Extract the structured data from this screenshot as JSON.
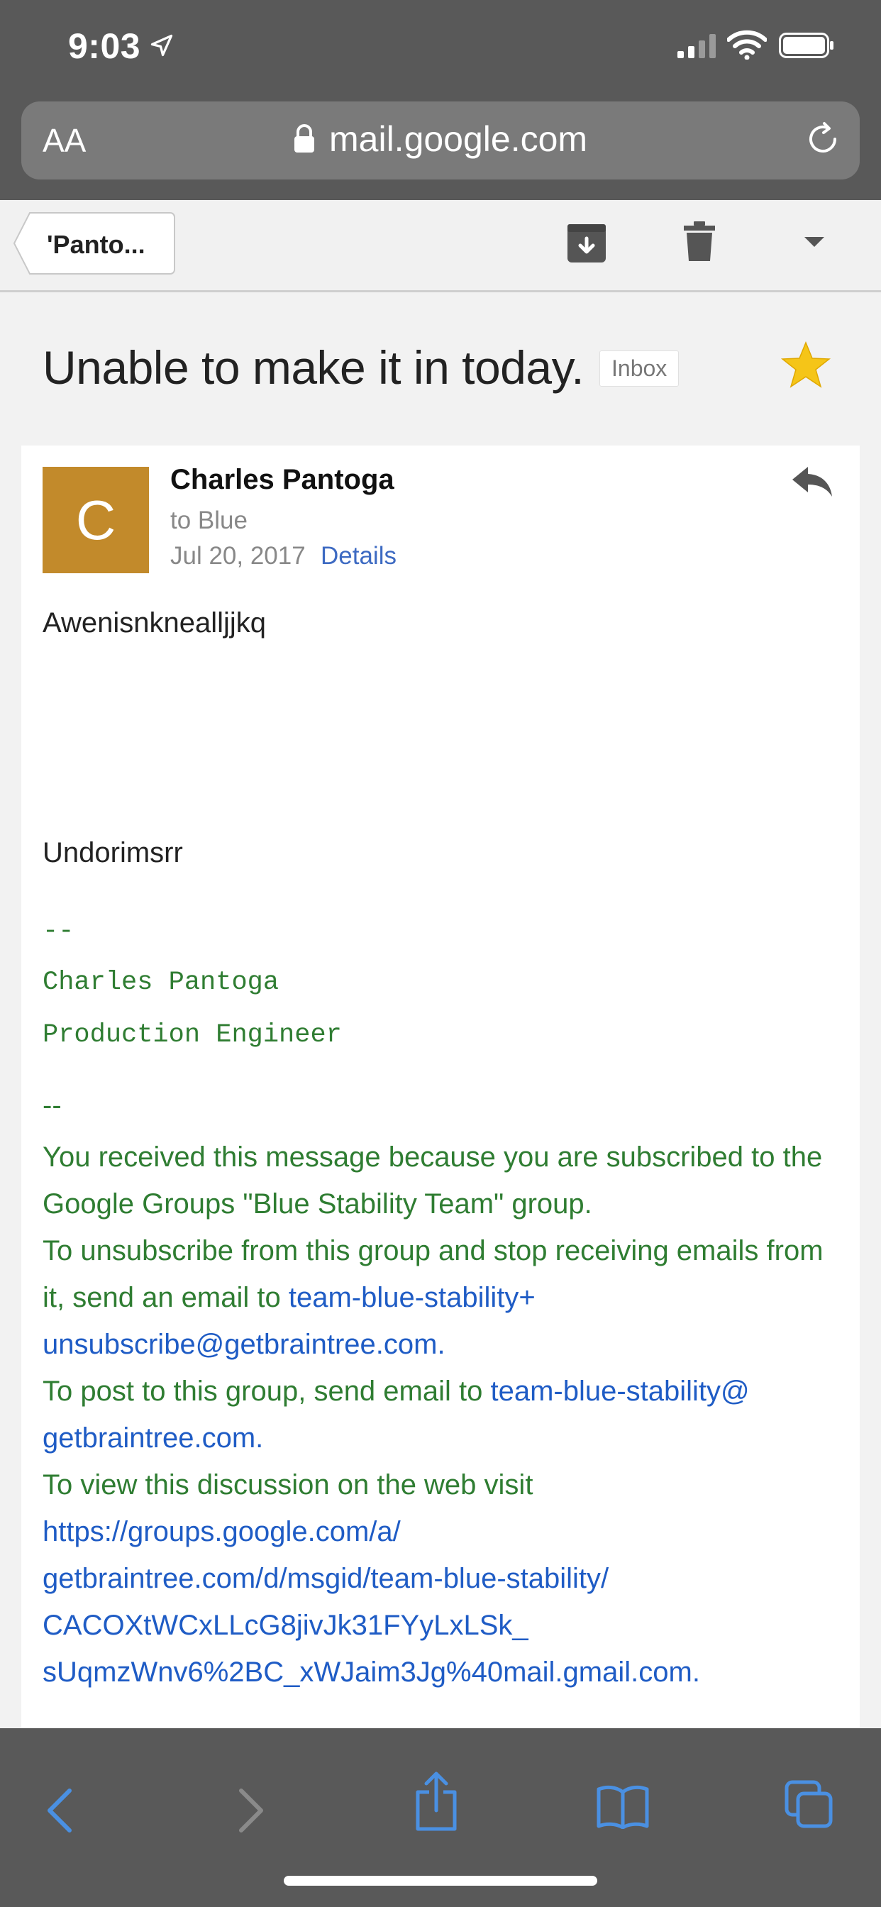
{
  "status_bar": {
    "time": "9:03"
  },
  "address_bar": {
    "aa": "AA",
    "url": "mail.google.com"
  },
  "toolbar": {
    "back_label": "'Panto..."
  },
  "message": {
    "subject": "Unable to make it in today.",
    "label": "Inbox",
    "avatar_letter": "C",
    "sender": "Charles Pantoga",
    "recipient": "to Blue",
    "date": "Jul 20, 2017",
    "details": "Details",
    "body_line_1": "Awenisnknealljjkq",
    "body_line_2": "Undorimsrr",
    "sig_sep": "--",
    "sig_name": "Charles Pantoga",
    "sig_title": "Production Engineer",
    "footer_sep": "--",
    "footer": {
      "line1": "You received this message because you are subscribed to the Google Groups \"Blue Stability Team\" group.",
      "unsub_text": "To unsubscribe from this group and stop receiving emails from it, send an email to ",
      "unsub_link": "team-blue-stability+ unsubscribe@getbraintree.com",
      "post_text": "To post to this group, send email to ",
      "post_link": "team-blue-stability@ getbraintree.com",
      "view_text": "To view this discussion on the web visit",
      "view_link_1": "https://groups.google.com/a/",
      "view_link_2": "getbraintree.com/d/msgid/team-blue-stability/",
      "view_link_3": "CACOXtWCxLLcG8jivJk31FYyLxLSk_",
      "view_link_4": "sUqmzWnv6%2BC_xWJaim3Jg%40mail.gmail.com",
      "period": "."
    }
  },
  "icons": {
    "location": "location-arrow-icon",
    "signal": "signal-icon",
    "wifi": "wifi-icon",
    "battery": "battery-icon",
    "lock": "lock-icon",
    "reload": "reload-icon",
    "archive": "archive-icon",
    "trash": "trash-icon",
    "more": "chevron-down-icon",
    "star": "star-icon",
    "reply": "reply-icon",
    "back": "back-arrow-icon",
    "forward": "forward-arrow-icon",
    "share": "share-icon",
    "bookmarks": "book-icon",
    "tabs": "tabs-icon"
  },
  "colors": {
    "chrome": "#595959",
    "avatar": "#c28a2b",
    "link": "#1f5cc5",
    "signature_green": "#2f7d32",
    "star": "#f5c518",
    "ios_blue": "#4a90e2"
  }
}
